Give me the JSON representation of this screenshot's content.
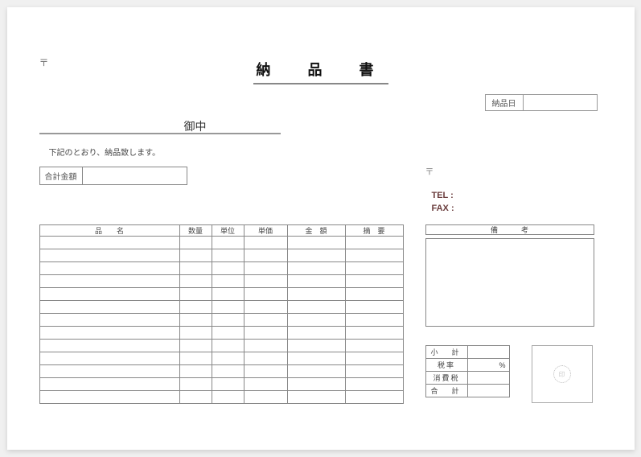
{
  "title": "納　品　書",
  "postal_mark": "〒",
  "date": {
    "label": "納品日",
    "value": ""
  },
  "addressee_suffix": "御中",
  "intro_text": "下記のとおり、納品致します。",
  "total": {
    "label": "合計金額",
    "value": ""
  },
  "sender": {
    "postal_mark": "〒",
    "tel_label": "TEL :",
    "fax_label": "FAX :"
  },
  "items": {
    "headers": {
      "name": "品　　名",
      "qty": "数量",
      "unit": "単位",
      "price": "単価",
      "amount": "金　額",
      "note": "摘　要"
    },
    "rows": [
      {
        "name": "",
        "qty": "",
        "unit": "",
        "price": "",
        "amount": "",
        "note": ""
      },
      {
        "name": "",
        "qty": "",
        "unit": "",
        "price": "",
        "amount": "",
        "note": ""
      },
      {
        "name": "",
        "qty": "",
        "unit": "",
        "price": "",
        "amount": "",
        "note": ""
      },
      {
        "name": "",
        "qty": "",
        "unit": "",
        "price": "",
        "amount": "",
        "note": ""
      },
      {
        "name": "",
        "qty": "",
        "unit": "",
        "price": "",
        "amount": "",
        "note": ""
      },
      {
        "name": "",
        "qty": "",
        "unit": "",
        "price": "",
        "amount": "",
        "note": ""
      },
      {
        "name": "",
        "qty": "",
        "unit": "",
        "price": "",
        "amount": "",
        "note": ""
      },
      {
        "name": "",
        "qty": "",
        "unit": "",
        "price": "",
        "amount": "",
        "note": ""
      },
      {
        "name": "",
        "qty": "",
        "unit": "",
        "price": "",
        "amount": "",
        "note": ""
      },
      {
        "name": "",
        "qty": "",
        "unit": "",
        "price": "",
        "amount": "",
        "note": ""
      },
      {
        "name": "",
        "qty": "",
        "unit": "",
        "price": "",
        "amount": "",
        "note": ""
      },
      {
        "name": "",
        "qty": "",
        "unit": "",
        "price": "",
        "amount": "",
        "note": ""
      },
      {
        "name": "",
        "qty": "",
        "unit": "",
        "price": "",
        "amount": "",
        "note": ""
      }
    ]
  },
  "remarks": {
    "header": "備　考",
    "body": ""
  },
  "summary": {
    "subtotal": {
      "label": "小　計",
      "value": ""
    },
    "tax_rate": {
      "label": "税率",
      "value": "",
      "unit": "%"
    },
    "tax": {
      "label": "消費税",
      "value": ""
    },
    "total": {
      "label": "合　計",
      "value": ""
    }
  },
  "seal": {
    "placeholder": "印"
  }
}
